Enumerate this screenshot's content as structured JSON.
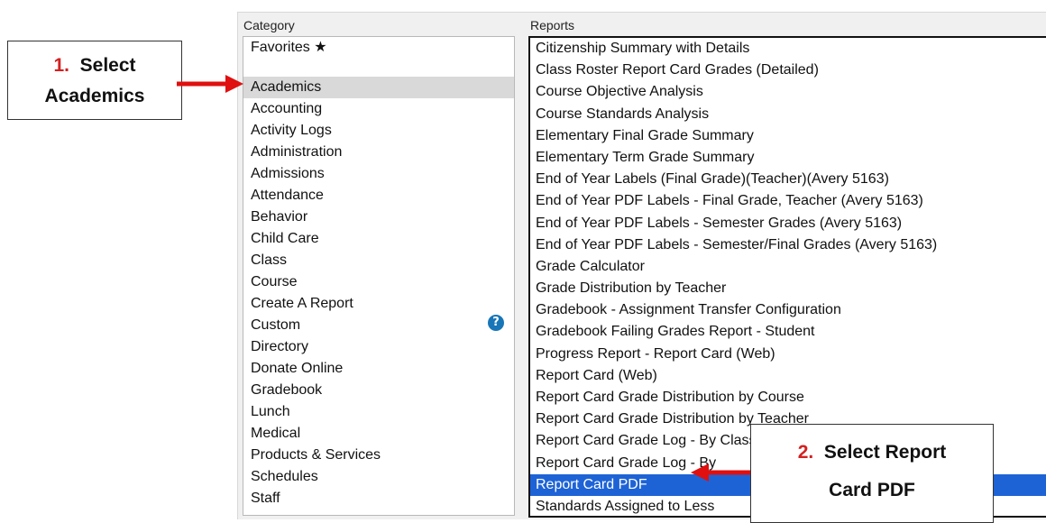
{
  "category": {
    "title": "Category",
    "items": [
      "Favorites ★",
      "",
      "Academics",
      "Accounting",
      "Activity Logs",
      "Administration",
      "Admissions",
      "Attendance",
      "Behavior",
      "Child Care",
      "Class",
      "Course",
      "Create A Report",
      "Custom",
      "Directory",
      "Donate Online",
      "Gradebook",
      "Lunch",
      "Medical",
      "Products & Services",
      "Schedules",
      "Staff"
    ],
    "selected": "Academics",
    "help_icon": "question-circle-icon",
    "help_glyph": "?"
  },
  "reports": {
    "title": "Reports",
    "items": [
      "Citizenship Summary with Details",
      "Class Roster Report Card Grades (Detailed)",
      "Course Objective Analysis",
      "Course Standards Analysis",
      "Elementary Final Grade Summary",
      "Elementary Term Grade Summary",
      "End of Year Labels (Final Grade)(Teacher)(Avery 5163)",
      "End of Year PDF Labels - Final Grade, Teacher (Avery 5163)",
      "End of Year PDF Labels - Semester Grades (Avery 5163)",
      "End of Year PDF Labels - Semester/Final Grades (Avery 5163)",
      "Grade Calculator",
      "Grade Distribution by Teacher",
      "Gradebook - Assignment Transfer Configuration",
      "Gradebook Failing Grades Report - Student",
      "Progress Report - Report Card (Web)",
      "Report Card (Web)",
      "Report Card Grade Distribution by Course",
      "Report Card Grade Distribution by Teacher",
      "Report Card Grade Log - By Class",
      "Report Card Grade Log - By",
      "Report Card PDF",
      "Standards Assigned to Less"
    ],
    "selected": "Report Card PDF"
  },
  "callouts": {
    "one": {
      "num": "1.",
      "line1": "Select",
      "line2": "Academics"
    },
    "two": {
      "num": "2.",
      "line1": "Select Report",
      "line2": "Card PDF"
    }
  },
  "colors": {
    "selection_blue": "#1e63d6",
    "selection_gray": "#d9d9d9",
    "arrow_red": "#e01010"
  }
}
